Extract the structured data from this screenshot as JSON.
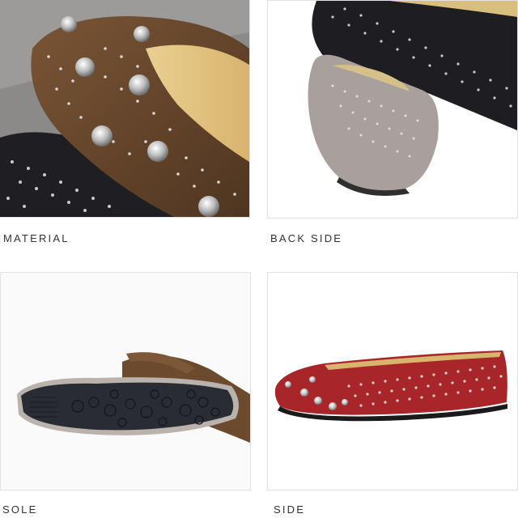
{
  "panels": [
    {
      "caption": "MATERIAL",
      "image": "studded-suede-toe-closeup"
    },
    {
      "caption": "BACK SIDE",
      "image": "grey-flat-heel-view"
    },
    {
      "caption": "SOLE",
      "image": "patterned-rubber-sole"
    },
    {
      "caption": "SIDE",
      "image": "red-studded-flat-side-view"
    }
  ],
  "colors": {
    "brown_suede": "#6b4a2e",
    "black_suede": "#1e1e22",
    "grey_suede": "#a49c98",
    "red_suede": "#a8262a",
    "stud_silver": "#c9c9c9",
    "caption_text": "#333333"
  }
}
